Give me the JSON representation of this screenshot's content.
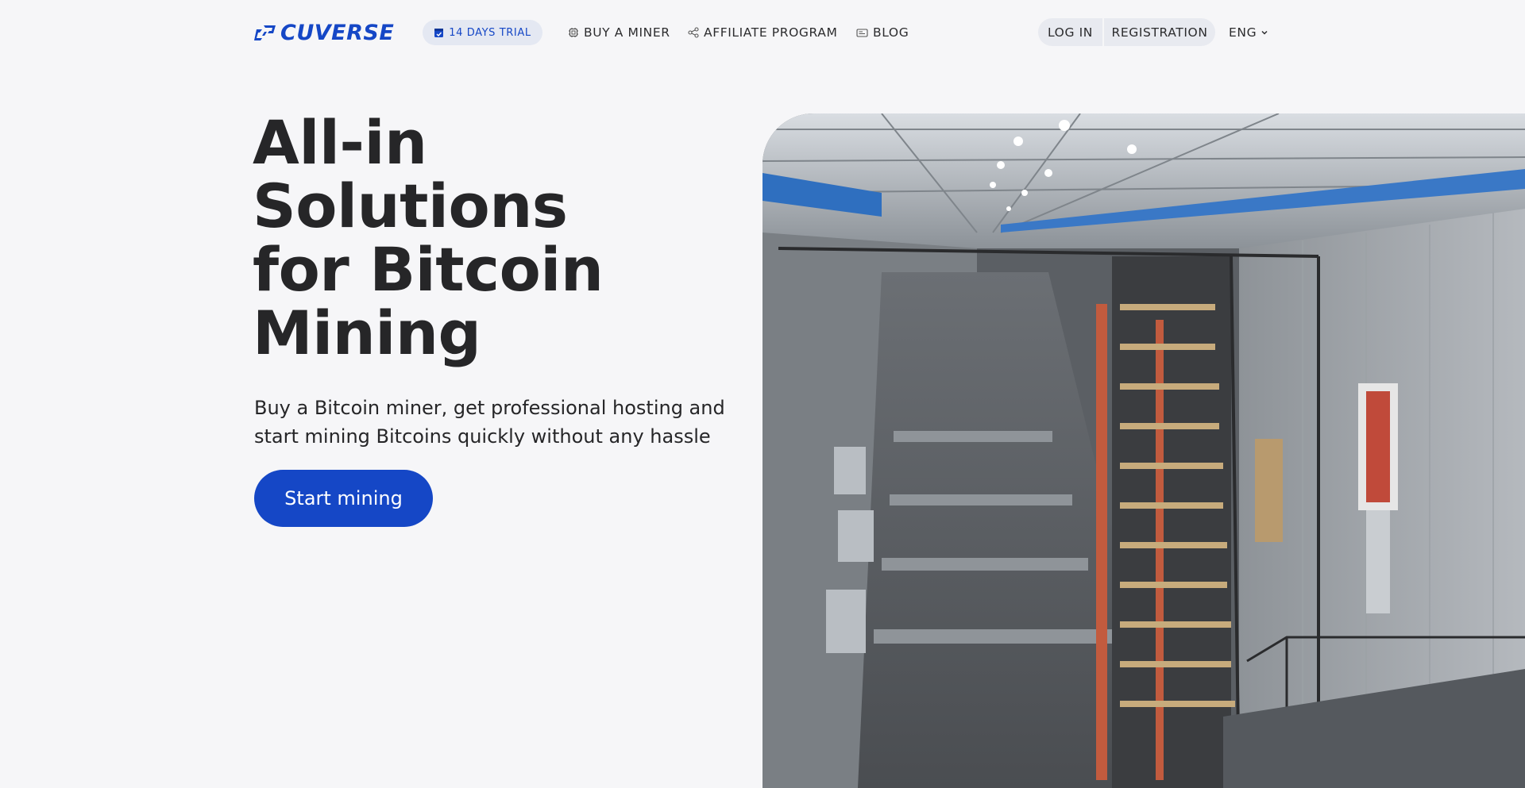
{
  "brand": {
    "name": "CUVERSE",
    "color": "#1547c6"
  },
  "header": {
    "trial": {
      "label": "14 DAYS TRIAL",
      "icon": "calendar-icon"
    },
    "nav": [
      {
        "label": "BUY A MINER",
        "icon": "chip-icon"
      },
      {
        "label": "AFFILIATE PROGRAM",
        "icon": "share-icon"
      },
      {
        "label": "BLOG",
        "icon": "newspaper-icon"
      }
    ],
    "auth": {
      "login_label": "LOG IN",
      "register_label": "REGISTRATION"
    },
    "language": {
      "label": "ENG",
      "icon": "chevron-down-icon"
    }
  },
  "hero": {
    "title_lines": [
      "All-in",
      "Solutions",
      "for Bitcoin",
      "Mining"
    ],
    "subtitle": "Buy a Bitcoin miner, get professional hosting and start mining Bitcoins quickly without any hassle",
    "cta_label": "Start mining",
    "image": "mining-warehouse-photo"
  }
}
